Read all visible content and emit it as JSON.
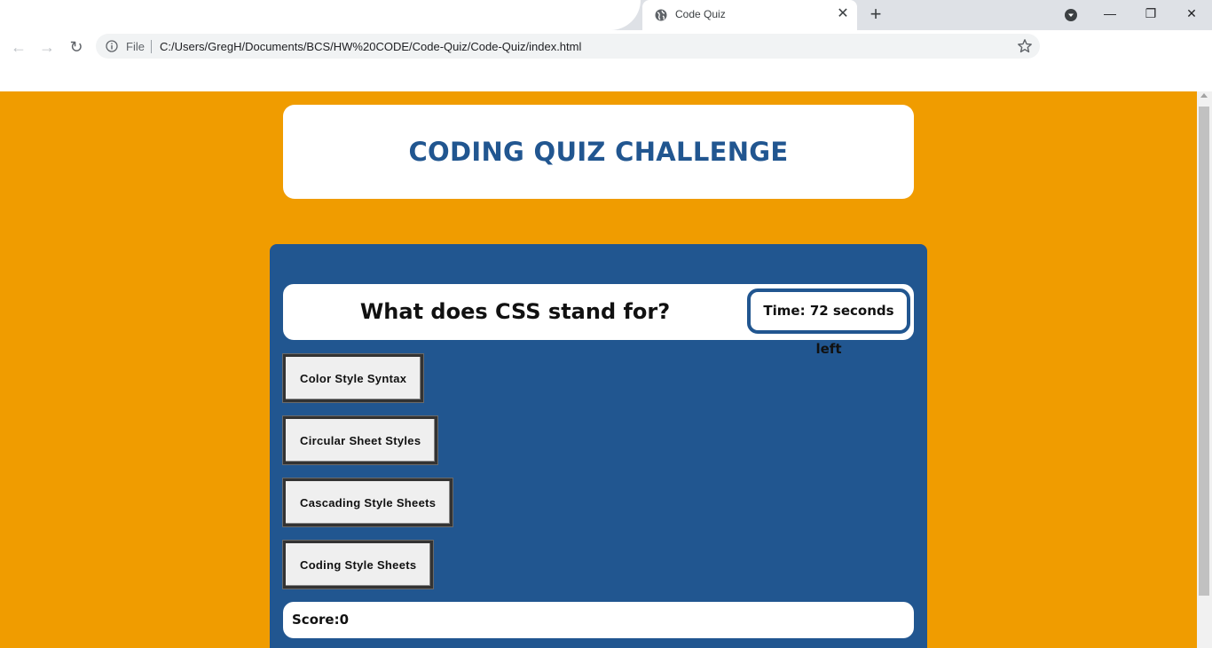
{
  "browser": {
    "tab_title": "Code Quiz",
    "tab_close": "✕",
    "new_tab": "+",
    "scheme_label": "File",
    "url": "C:/Users/GregH/Documents/BCS/HW%20CODE/Code-Quiz/Code-Quiz/index.html",
    "window_controls": {
      "minimize": "—",
      "restore": "❐",
      "close": "✕"
    },
    "nav": {
      "back": "←",
      "forward": "→",
      "reload": "↻"
    }
  },
  "page": {
    "header_title": "CODING QUIZ CHALLENGE",
    "question": "What does CSS stand for?",
    "timer": "Time: 72 seconds left",
    "answers": [
      "Color Style Syntax",
      "Circular Sheet Styles",
      "Cascading Style Sheets",
      "Coding Style Sheets"
    ],
    "score": "Score:0"
  },
  "colors": {
    "page_background": "#f09c00",
    "panel_blue": "#215690",
    "card_white": "#ffffff",
    "button_face": "#efefef"
  },
  "icons": [
    "globe-icon",
    "info-icon",
    "star-icon",
    "profile-icon"
  ]
}
